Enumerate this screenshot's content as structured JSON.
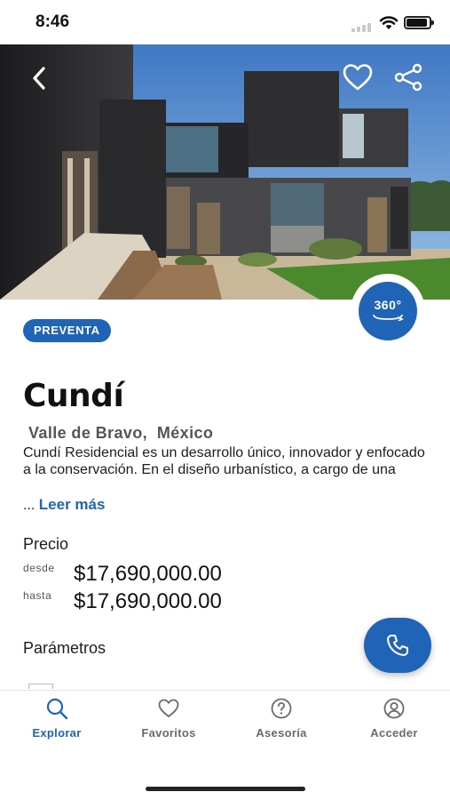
{
  "status_bar": {
    "time": "8:46"
  },
  "hero": {
    "badge_360": "360°"
  },
  "project": {
    "badge": "PREVENTA",
    "name": "Cundí",
    "location": "Valle de Bravo,  México",
    "description": "Cundí Residencial es un desarrollo único, innovador y enfocado a la conservación. En el diseño urbanístico, a cargo de una",
    "ellipsis": "...",
    "read_more": "Leer más"
  },
  "price": {
    "label": "Precio",
    "from_label": "desde",
    "from_value": "$17,690,000.00",
    "to_label": "hasta",
    "to_value": "$17,690,000.00"
  },
  "parameters": {
    "label": "Parámetros"
  },
  "tabs": [
    {
      "label": "Explorar",
      "icon": "search-icon",
      "active": true
    },
    {
      "label": "Favoritos",
      "icon": "heart-icon",
      "active": false
    },
    {
      "label": "Asesoría",
      "icon": "help-circle-icon",
      "active": false
    },
    {
      "label": "Acceder",
      "icon": "user-circle-icon",
      "active": false
    }
  ],
  "colors": {
    "accent": "#2064b8",
    "tab_inactive": "#6a6a6a"
  }
}
